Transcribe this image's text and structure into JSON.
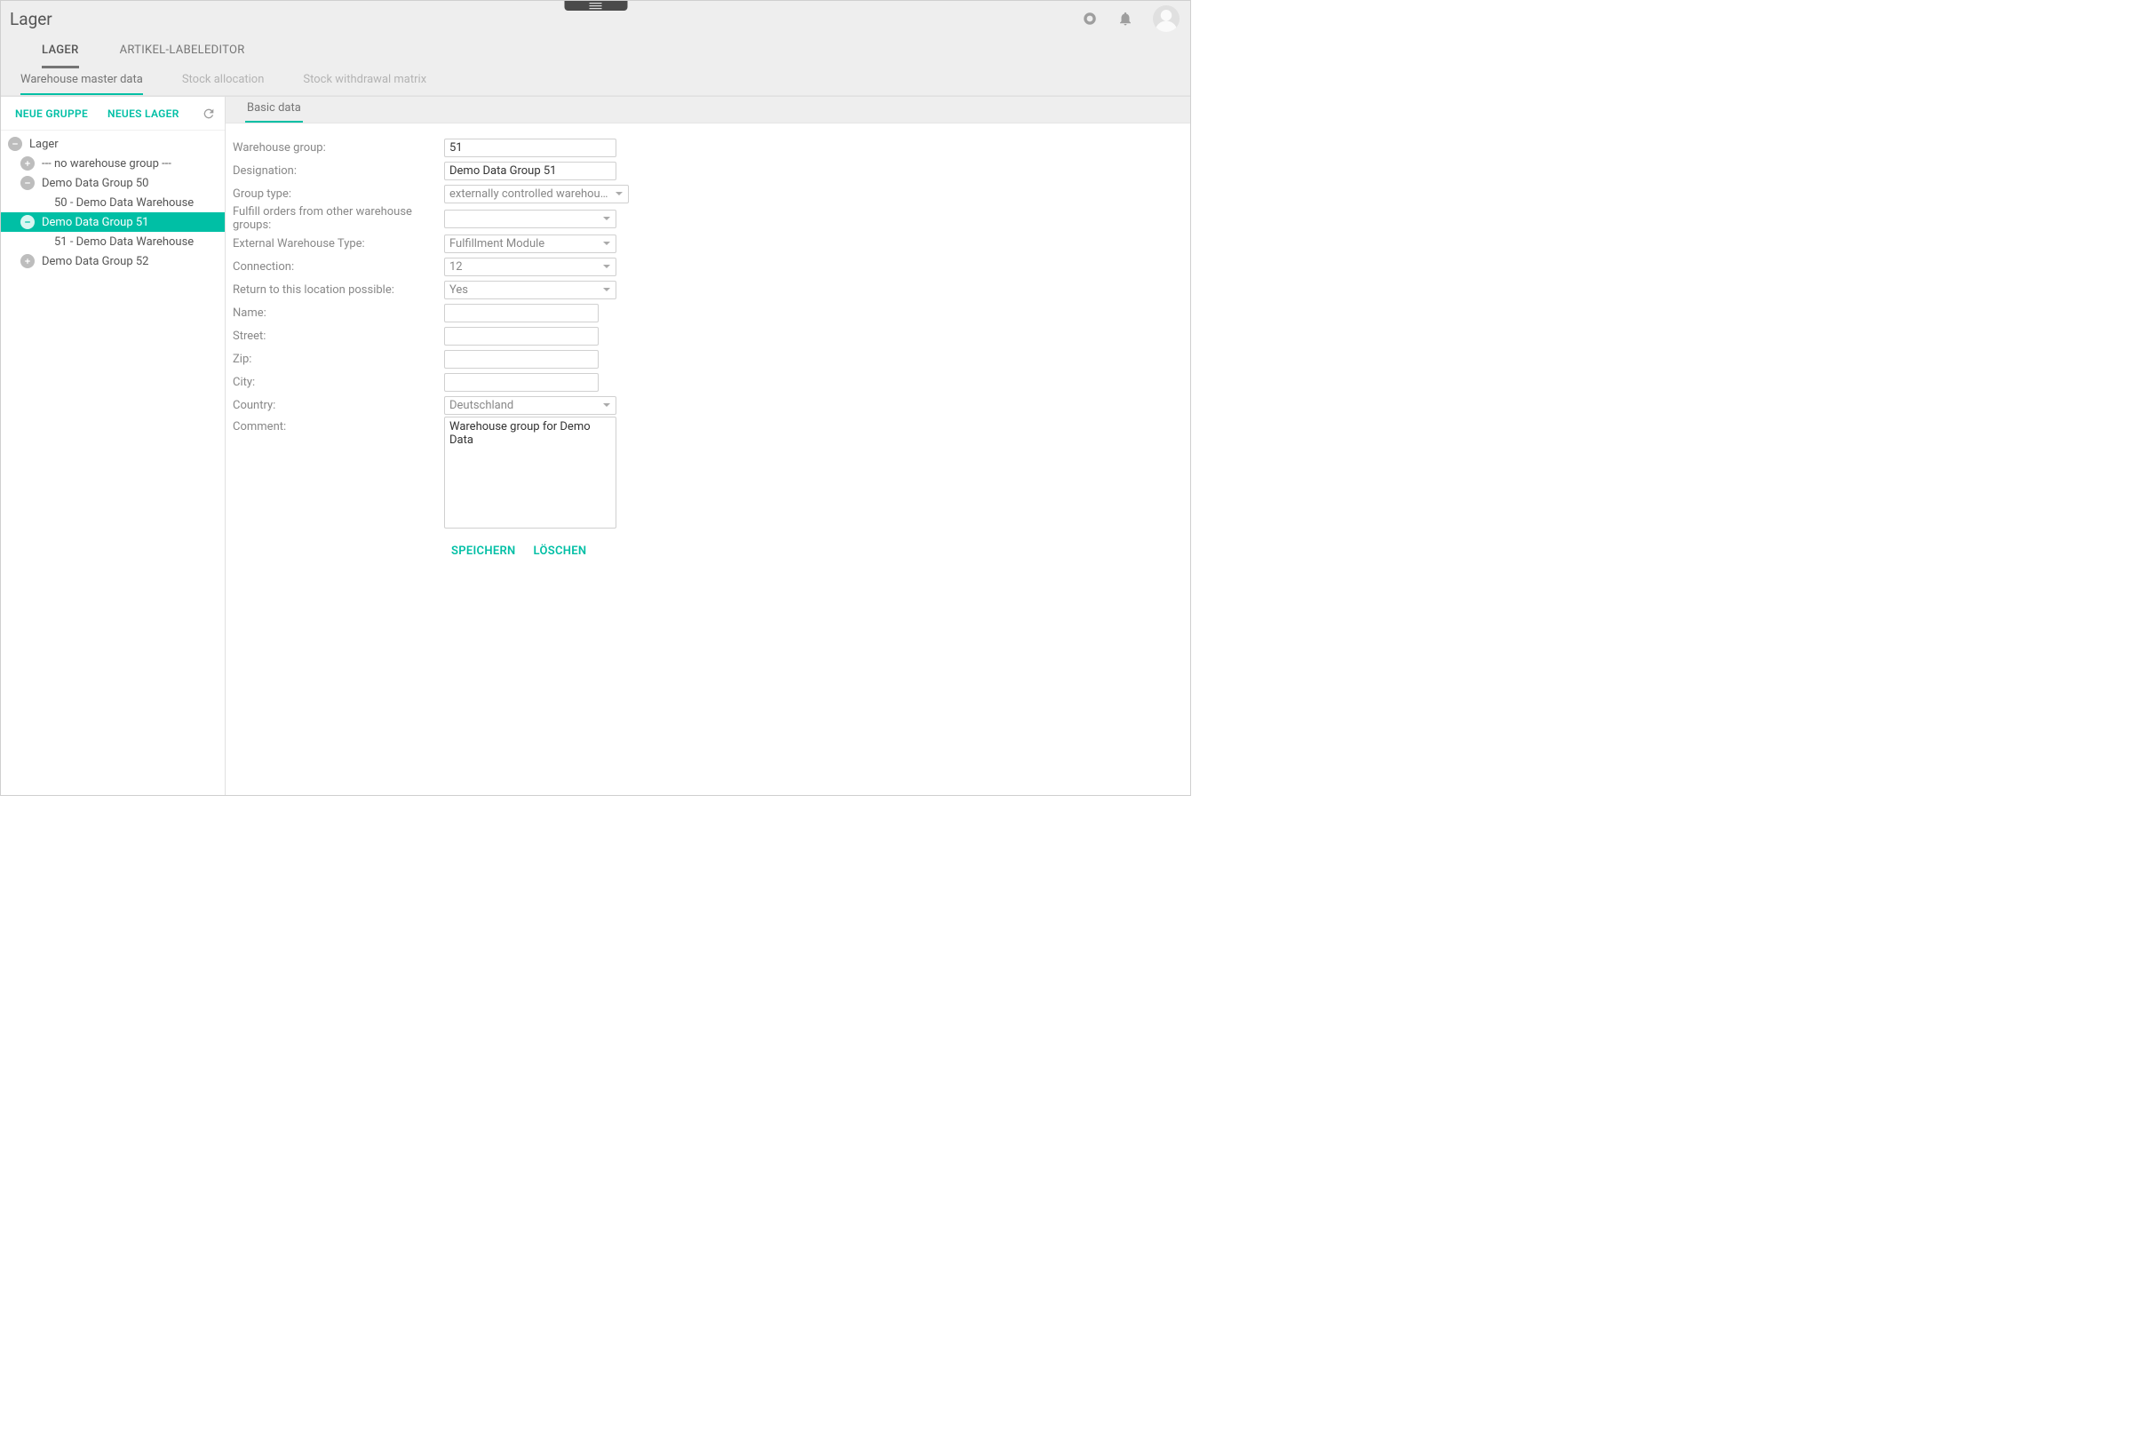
{
  "header": {
    "title": "Lager",
    "primary_tabs": [
      {
        "label": "LAGER",
        "active": true
      },
      {
        "label": "ARTIKEL-LABELEDITOR",
        "active": false
      }
    ],
    "sub_tabs": [
      {
        "label": "Warehouse master data",
        "active": true
      },
      {
        "label": "Stock allocation",
        "active": false
      },
      {
        "label": "Stock withdrawal matrix",
        "active": false
      }
    ]
  },
  "sidebar": {
    "actions": {
      "new_group": "NEUE GRUPPE",
      "new_warehouse": "NEUES LAGER"
    },
    "tree": {
      "root_label": "Lager",
      "nodes": [
        {
          "label": "--- no warehouse group ---",
          "expand": "plus",
          "indent": 1,
          "selected": false
        },
        {
          "label": "Demo Data Group 50",
          "expand": "minus",
          "indent": 1,
          "selected": false
        },
        {
          "label": "50 - Demo Data Warehouse",
          "expand": null,
          "indent": 2,
          "selected": false
        },
        {
          "label": "Demo Data Group 51",
          "expand": "minus",
          "indent": 1,
          "selected": true
        },
        {
          "label": "51 - Demo Data Warehouse",
          "expand": null,
          "indent": 2,
          "selected": false
        },
        {
          "label": "Demo Data Group 52",
          "expand": "plus",
          "indent": 1,
          "selected": false
        }
      ]
    }
  },
  "content": {
    "tab_label": "Basic data",
    "fields": {
      "warehouse_group": {
        "label": "Warehouse group:",
        "type": "text",
        "value": "51"
      },
      "designation": {
        "label": "Designation:",
        "type": "text",
        "value": "Demo Data Group 51"
      },
      "group_type": {
        "label": "Group type:",
        "type": "select",
        "value": "externally controlled warehouse"
      },
      "fulfill_other": {
        "label": "Fulfill orders from other warehouse groups:",
        "type": "select",
        "value": ""
      },
      "external_wh_type": {
        "label": "External Warehouse Type:",
        "type": "select",
        "value": "Fulfillment Module"
      },
      "connection": {
        "label": "Connection:",
        "type": "select",
        "value": "12"
      },
      "return_possible": {
        "label": "Return to this location possible:",
        "type": "select",
        "value": "Yes"
      },
      "name": {
        "label": "Name:",
        "type": "text",
        "value": ""
      },
      "street": {
        "label": "Street:",
        "type": "text",
        "value": ""
      },
      "zip": {
        "label": "Zip:",
        "type": "text",
        "value": ""
      },
      "city": {
        "label": "City:",
        "type": "text",
        "value": ""
      },
      "country": {
        "label": "Country:",
        "type": "select",
        "value": "Deutschland"
      },
      "comment": {
        "label": "Comment:",
        "type": "textarea",
        "value": "Warehouse group for Demo Data"
      }
    },
    "buttons": {
      "save": "SPEICHERN",
      "delete": "LÖSCHEN"
    }
  }
}
